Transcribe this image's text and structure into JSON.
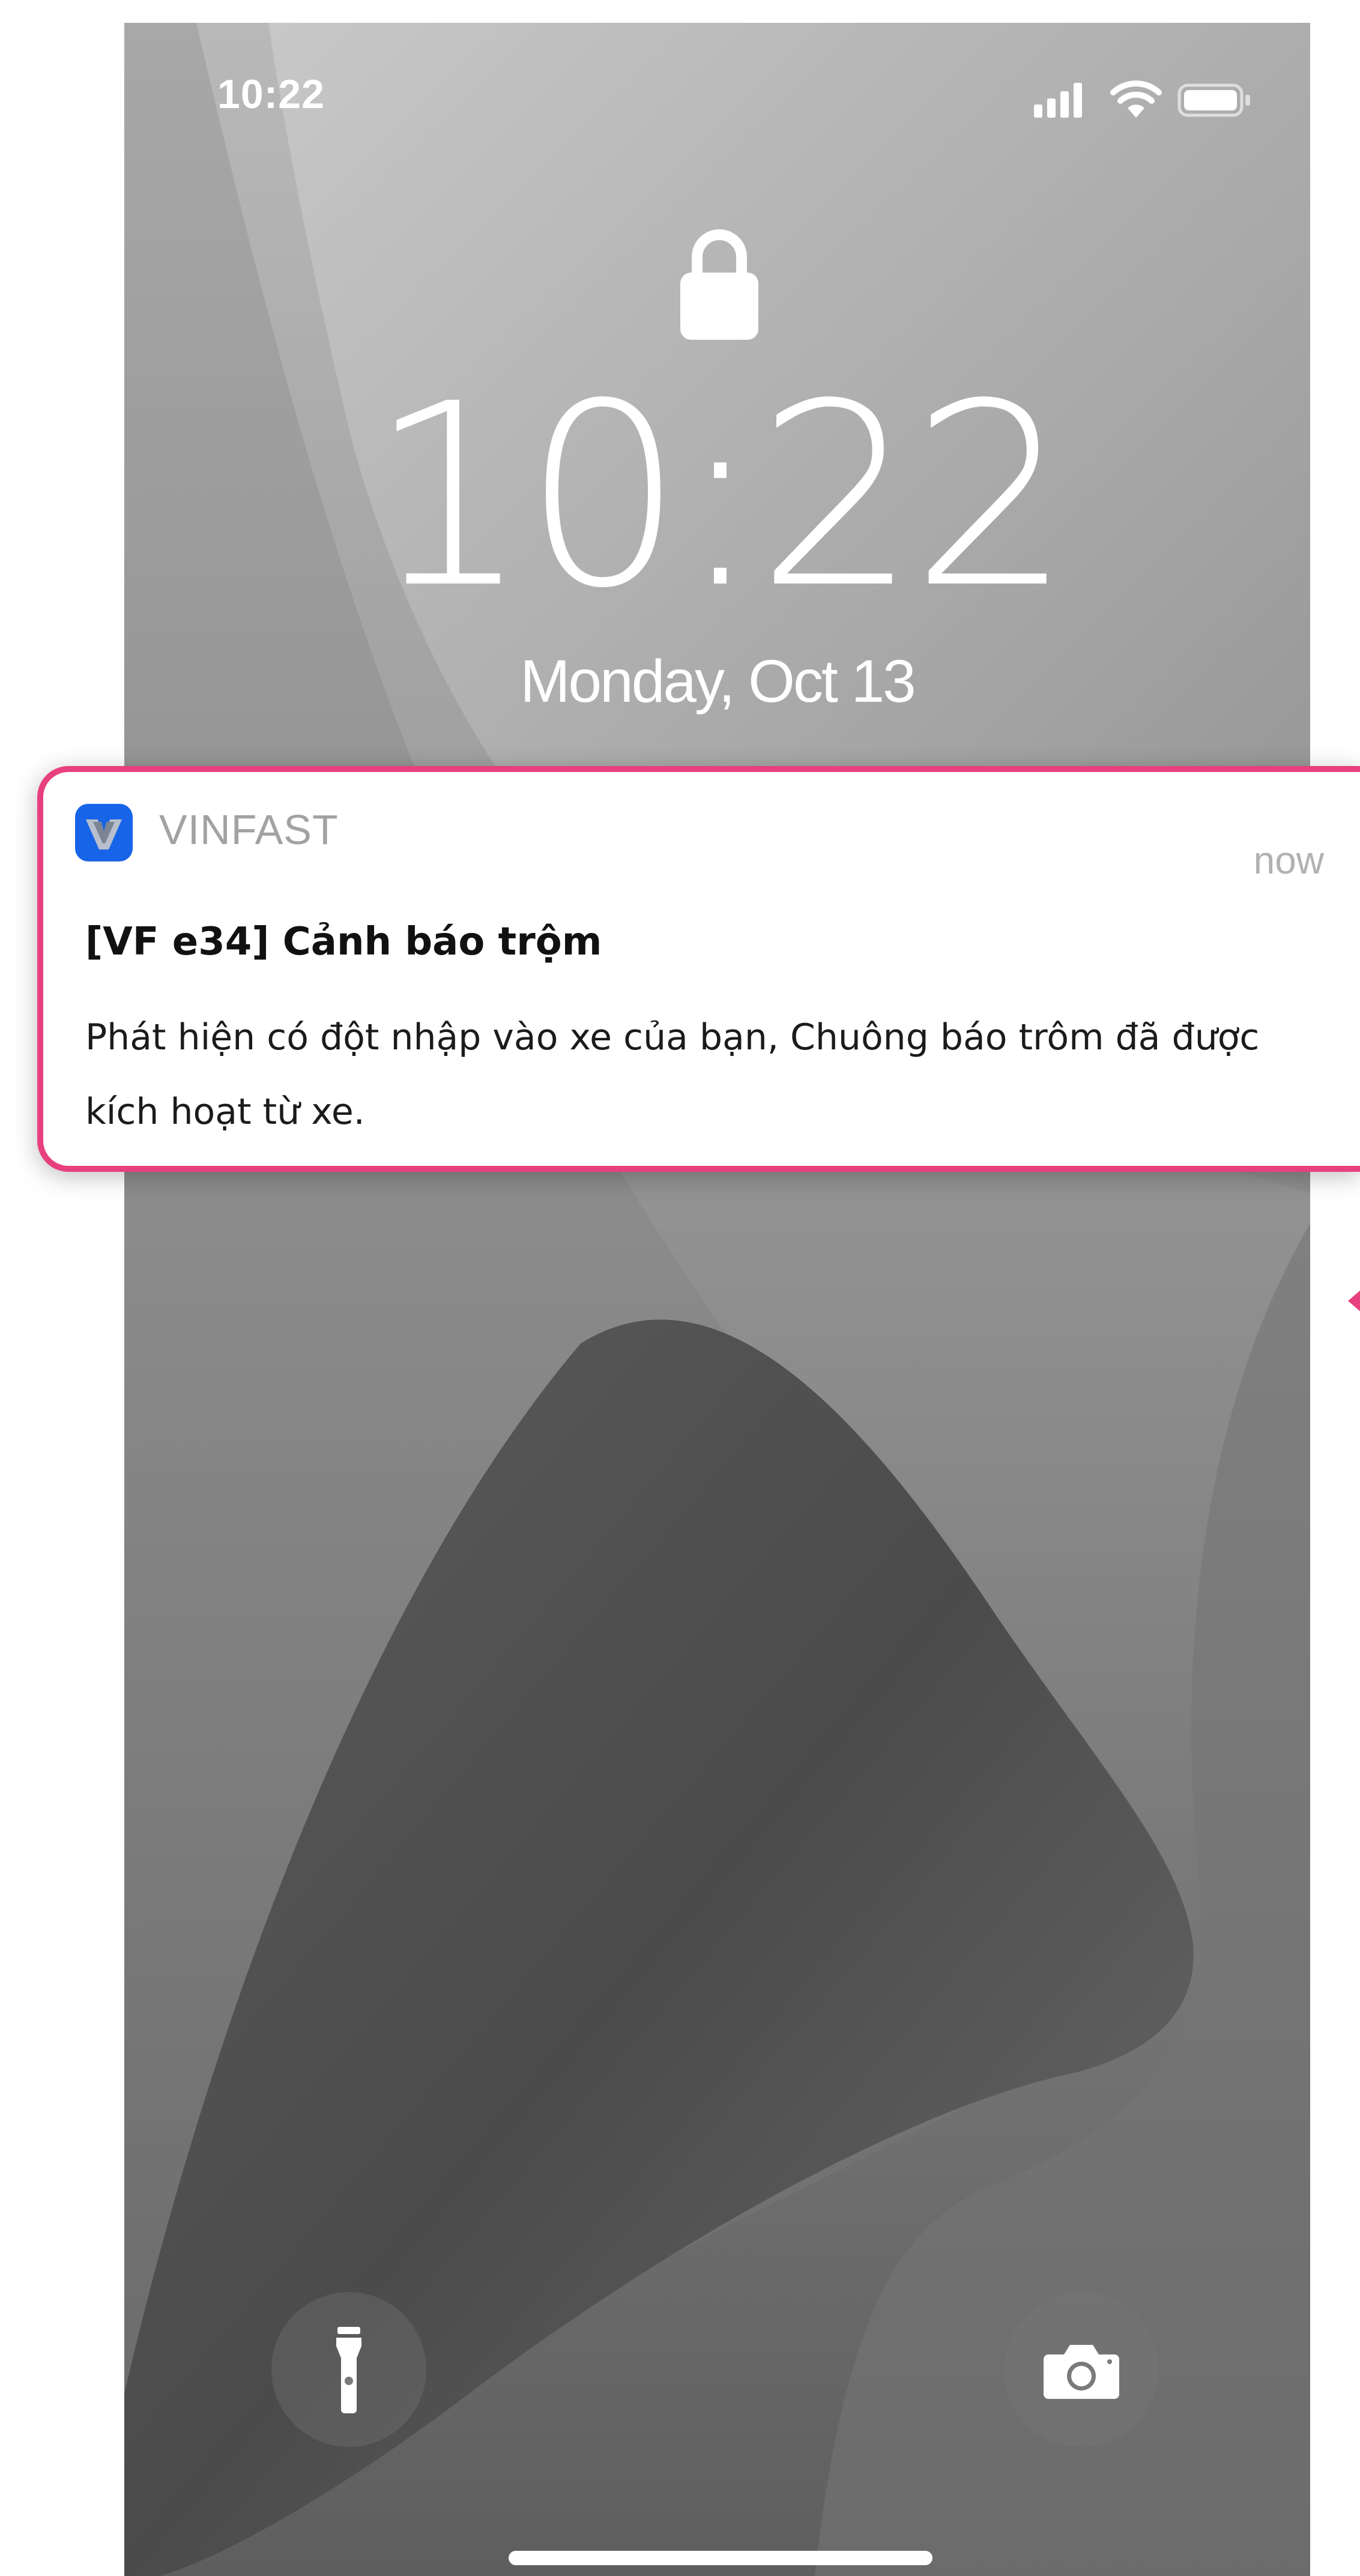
{
  "status_bar": {
    "time": "10:22"
  },
  "lock_screen": {
    "clock": "10:22",
    "date": "Monday, Oct 13"
  },
  "notification": {
    "app_name": "VINFAST",
    "time": "now",
    "title": "[VF e34] Cảnh báo trộm",
    "body": "Phát hiện có đột nhập vào xe của bạn, Chuông báo trôm đã được kích hoạt từ xe.",
    "icon": "vinfast-logo-icon",
    "highlight_color": "#e8407e",
    "icon_color": "#1764e8"
  },
  "controls": {
    "left_icon": "flashlight-icon",
    "right_icon": "camera-icon"
  },
  "colors": {
    "accent": "#e8407e"
  }
}
